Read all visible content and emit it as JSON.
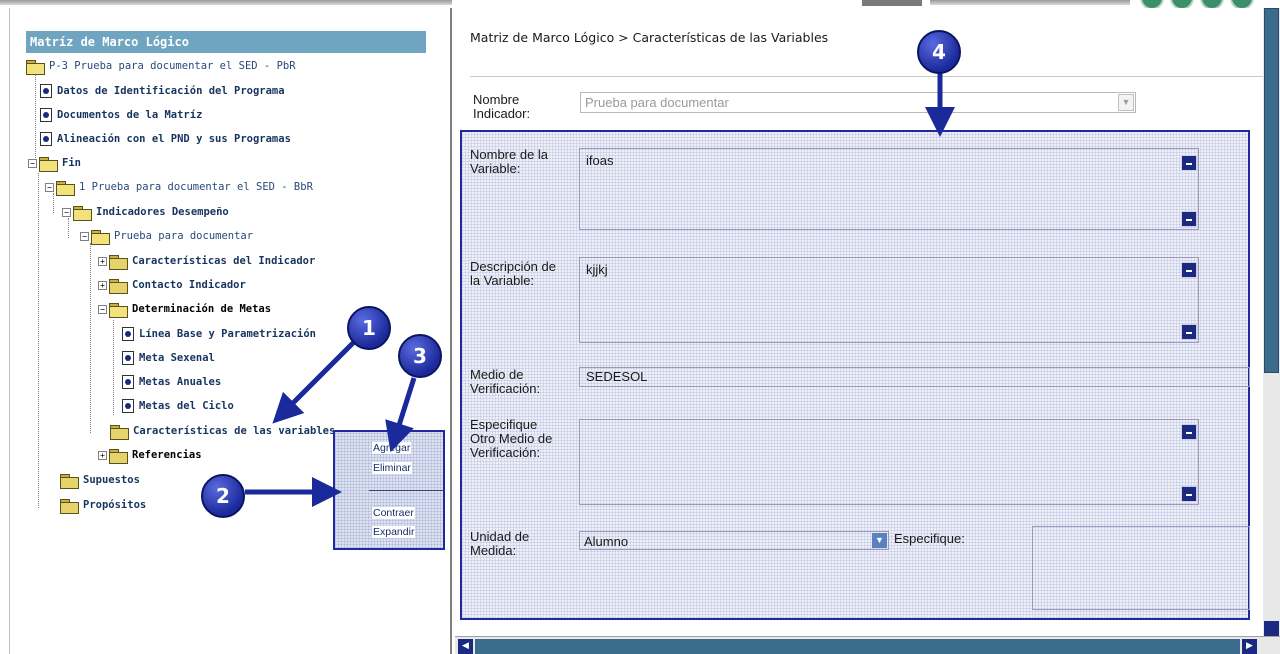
{
  "tree": {
    "header": "Matríz de Marco Lógico",
    "root": "P-3 Prueba para documentar el SED - PbR",
    "items": {
      "datos": "Datos de Identificación del Programa",
      "documentos": "Documentos de la Matríz",
      "alineacion": "Alineación con el PND y sus Programas",
      "fin": "Fin",
      "fin_child": "1 Prueba para documentar el SED - BbR",
      "indicadores": "Indicadores Desempeño",
      "prueba": "Prueba para documentar",
      "caracteristicas_ind": "Características del Indicador",
      "contacto": "Contacto Indicador",
      "determinacion": "Determinación de Metas",
      "linea_base": "Línea Base y Parametrización",
      "meta_sexenal": "Meta Sexenal",
      "metas_anuales": "Metas Anuales",
      "metas_ciclo": "Metas del Ciclo",
      "caracteristicas_var": "Características de las variables",
      "referencias": "Referencias",
      "supuestos": "Supuestos",
      "propositos": "Propósitos"
    }
  },
  "context_menu": {
    "agregar": "Agregar",
    "eliminar": "Eliminar",
    "contraer": "Contraer",
    "expandir": "Expandir"
  },
  "main": {
    "breadcrumb": "Matriz de Marco Lógico > Características de las Variables",
    "nombre_indicador": {
      "label_line1": "Nombre",
      "label_line2": "Indicador:",
      "value": "Prueba para documentar"
    },
    "nombre_variable": {
      "label_line1": "Nombre de la",
      "label_line2": "Variable:",
      "value": "ifoas"
    },
    "descripcion_variable": {
      "label_line1": "Descripción de",
      "label_line2": "la Variable:",
      "value": "kjjkj"
    },
    "medio_verificacion": {
      "label_line1": "Medio de",
      "label_line2": "Verificación:",
      "value": "SEDESOL"
    },
    "otro_medio": {
      "label_line1": "Especifique",
      "label_line2": "Otro Medio de",
      "label_line3": "Verificación:",
      "value": ""
    },
    "unidad_medida": {
      "label_line1": "Unidad de",
      "label_line2": "Medida:",
      "value": "Alumno"
    },
    "especifique": {
      "label": "Especifique:",
      "value": ""
    }
  },
  "markers": [
    "1",
    "2",
    "3",
    "4"
  ],
  "colors": {
    "header_bg": "#6fa5c0",
    "annotation_blue": "#1a2a9a",
    "form_border": "#2228a0"
  }
}
